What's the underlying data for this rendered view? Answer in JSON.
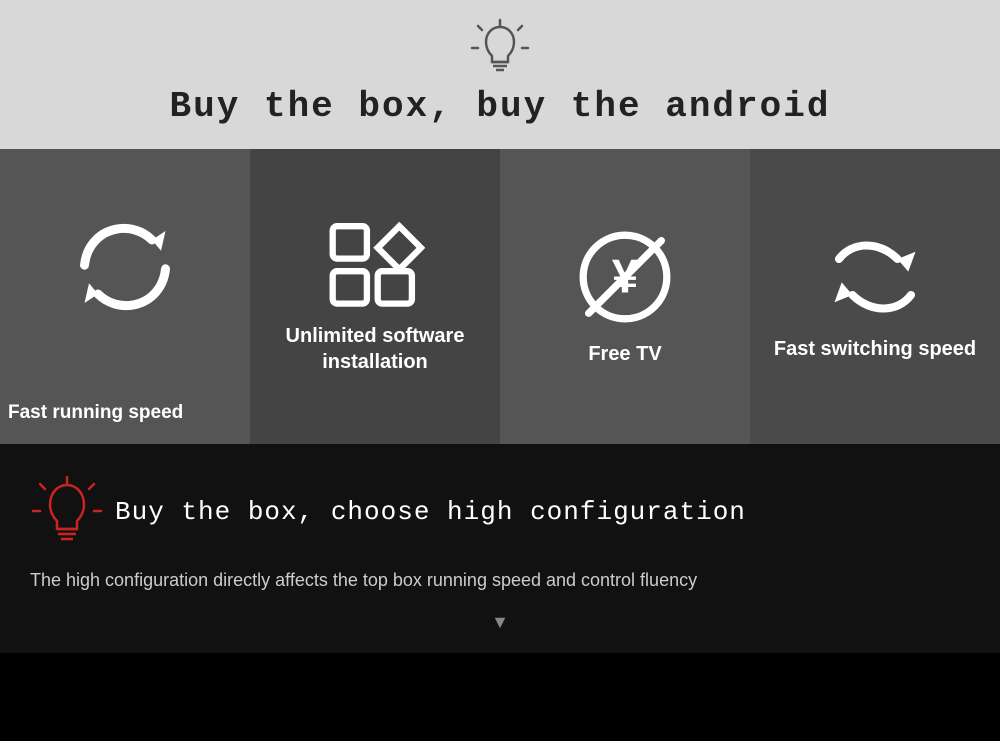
{
  "top": {
    "title": "Buy the box, buy the android"
  },
  "features": [
    {
      "id": "fast-running",
      "label": "Fast running speed",
      "icon": "sync"
    },
    {
      "id": "unlimited-software",
      "label": "Unlimited software installation",
      "icon": "apps"
    },
    {
      "id": "free-tv",
      "label": "Free TV",
      "icon": "noyen"
    },
    {
      "id": "fast-switching",
      "label": "Fast switching speed",
      "icon": "switch"
    }
  ],
  "bottom": {
    "title": "Buy the box, choose high configuration",
    "description": "The high configuration directly affects the top box running speed and control fluency"
  },
  "colors": {
    "topBg": "#d8d8d8",
    "feature1Bg": "#555555",
    "feature2Bg": "#444444",
    "feature3Bg": "#555555",
    "feature4Bg": "#4a4a4a",
    "bottomBg": "#111111",
    "accentRed": "#cc0000"
  }
}
